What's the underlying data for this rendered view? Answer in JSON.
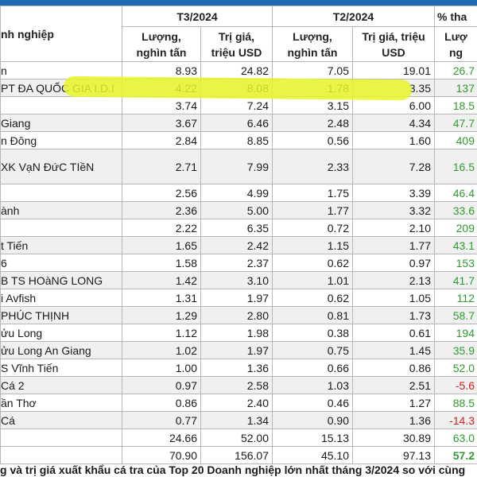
{
  "headers": {
    "col_name": "nh nghiệp",
    "group_t3": "T3/2024",
    "group_t2": "T2/2024",
    "group_pct": "% tha",
    "sub_t3_vol": [
      "Lượng,",
      "nghìn tấn"
    ],
    "sub_t3_val": [
      "Trị giá,",
      "triệu USD"
    ],
    "sub_t2_vol": [
      "Lượng,",
      "nghìn tấn"
    ],
    "sub_t2_val": [
      "Trị giá, triệu",
      "USD"
    ],
    "sub_pct": [
      "Lượ",
      "ng"
    ]
  },
  "rows": [
    {
      "name": "n",
      "t3_vol": "8.93",
      "t3_val": "24.82",
      "t2_vol": "7.05",
      "t2_val": "19.01",
      "pct": "26.7",
      "neg": false
    },
    {
      "name": " PT ĐA QUỐC GIA I.D.I",
      "t3_vol": "4.22",
      "t3_val": "8.08",
      "t2_vol": "1.78",
      "t2_val": "3.35",
      "pct": "137",
      "neg": false
    },
    {
      "name": "",
      "t3_vol": "3.74",
      "t3_val": "7.24",
      "t2_vol": "3.15",
      "t2_val": "6.00",
      "pct": "18.5",
      "neg": false
    },
    {
      "name": " Giang",
      "t3_vol": "3.67",
      "t3_val": "6.46",
      "t2_vol": "2.48",
      "t2_val": "4.34",
      "pct": "47.7",
      "neg": false
    },
    {
      "name": "n Đông",
      "t3_vol": "2.84",
      "t3_val": "8.85",
      "t2_vol": "0.56",
      "t2_val": "1.60",
      "pct": "409",
      "neg": false
    },
    {
      "name": "XK VạN ĐứC TIềN",
      "t3_vol": "2.71",
      "t3_val": "7.99",
      "t2_vol": "2.33",
      "t2_val": "7.28",
      "pct": "16.5",
      "neg": false
    },
    {
      "name": "",
      "t3_vol": "2.56",
      "t3_val": "4.99",
      "t2_vol": "1.75",
      "t2_val": "3.39",
      "pct": "46.4",
      "neg": false
    },
    {
      "name": "ành",
      "t3_vol": "2.36",
      "t3_val": "5.00",
      "t2_vol": "1.77",
      "t2_val": "3.32",
      "pct": "33.6",
      "neg": false
    },
    {
      "name": "",
      "t3_vol": "2.22",
      "t3_val": "6.35",
      "t2_vol": "0.72",
      "t2_val": "2.10",
      "pct": "209",
      "neg": false
    },
    {
      "name": "t Tiến",
      "t3_vol": "1.65",
      "t3_val": "2.42",
      "t2_vol": "1.15",
      "t2_val": "1.77",
      "pct": "43.1",
      "neg": false
    },
    {
      "name": "6",
      "t3_vol": "1.58",
      "t3_val": "2.37",
      "t2_vol": "0.62",
      "t2_val": "0.97",
      "pct": "153",
      "neg": false
    },
    {
      "name": "B TS HOàNG LONG",
      "t3_vol": "1.42",
      "t3_val": "3.10",
      "t2_vol": "1.01",
      "t2_val": "2.13",
      "pct": "41.7",
      "neg": false
    },
    {
      "name": "i Avfish",
      "t3_vol": "1.31",
      "t3_val": "1.97",
      "t2_vol": "0.62",
      "t2_val": "1.05",
      "pct": "112",
      "neg": false
    },
    {
      "name": "PHÚC THỊNH",
      "t3_vol": "1.29",
      "t3_val": "2.80",
      "t2_vol": "0.81",
      "t2_val": "1.73",
      "pct": "58.7",
      "neg": false
    },
    {
      "name": "ửu Long",
      "t3_vol": "1.12",
      "t3_val": "1.98",
      "t2_vol": "0.38",
      "t2_val": "0.61",
      "pct": "194",
      "neg": false
    },
    {
      "name": "ửu Long An Giang",
      "t3_vol": "1.02",
      "t3_val": "1.97",
      "t2_vol": "0.75",
      "t2_val": "1.45",
      "pct": "35.9",
      "neg": false
    },
    {
      "name": "S Vĩnh Tiến",
      "t3_vol": "1.00",
      "t3_val": "1.36",
      "t2_vol": "0.66",
      "t2_val": "0.86",
      "pct": "52.0",
      "neg": false
    },
    {
      "name": "Cá 2",
      "t3_vol": "0.97",
      "t3_val": "2.58",
      "t2_vol": "1.03",
      "t2_val": "2.51",
      "pct": "-5.6",
      "neg": true
    },
    {
      "name": "ần Thơ",
      "t3_vol": "0.86",
      "t3_val": "2.40",
      "t2_vol": "0.46",
      "t2_val": "1.27",
      "pct": "88.5",
      "neg": false
    },
    {
      "name": "Cá",
      "t3_vol": "0.77",
      "t3_val": "1.34",
      "t2_vol": "0.90",
      "t2_val": "1.36",
      "pct": "-14.3",
      "neg": true
    },
    {
      "name": "",
      "t3_vol": "24.66",
      "t3_val": "52.00",
      "t2_vol": "15.13",
      "t2_val": "30.89",
      "pct": "63.0",
      "neg": false
    },
    {
      "name": "",
      "t3_vol": "70.90",
      "t3_val": "156.07",
      "t2_vol": "45.10",
      "t2_val": "97.13",
      "pct": "57.2",
      "neg": false
    }
  ],
  "caption": "g và trị giá xuất khẩu cá tra của Top 20 Doanh nghiệp lớn nhất tháng 3/2024 so với cùng"
}
